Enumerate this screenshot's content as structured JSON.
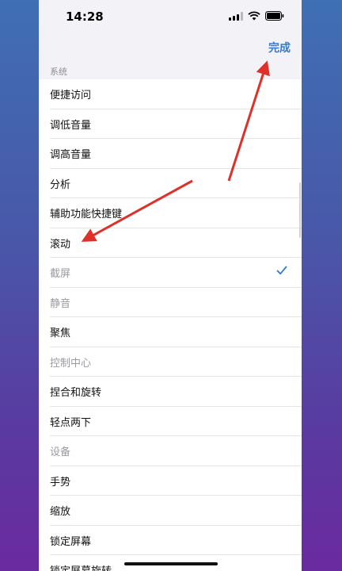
{
  "status_bar": {
    "time": "14:28"
  },
  "nav": {
    "done_label": "完成"
  },
  "section": {
    "title": "系统"
  },
  "items": [
    {
      "label": "便捷访问",
      "enabled": true,
      "checked": false
    },
    {
      "label": "调低音量",
      "enabled": true,
      "checked": false
    },
    {
      "label": "调高音量",
      "enabled": true,
      "checked": false
    },
    {
      "label": "分析",
      "enabled": true,
      "checked": false
    },
    {
      "label": "辅助功能快捷键",
      "enabled": true,
      "checked": false
    },
    {
      "label": "滚动",
      "enabled": true,
      "checked": false
    },
    {
      "label": "截屏",
      "enabled": false,
      "checked": true
    },
    {
      "label": "静音",
      "enabled": false,
      "checked": false
    },
    {
      "label": "聚焦",
      "enabled": true,
      "checked": false
    },
    {
      "label": "控制中心",
      "enabled": false,
      "checked": false
    },
    {
      "label": "捏合和旋转",
      "enabled": true,
      "checked": false
    },
    {
      "label": "轻点两下",
      "enabled": true,
      "checked": false
    },
    {
      "label": "设备",
      "enabled": false,
      "checked": false
    },
    {
      "label": "手势",
      "enabled": true,
      "checked": false
    },
    {
      "label": "缩放",
      "enabled": true,
      "checked": false
    },
    {
      "label": "锁定屏幕",
      "enabled": true,
      "checked": false
    },
    {
      "label": "锁定屏幕旋转",
      "enabled": true,
      "checked": false
    }
  ],
  "colors": {
    "accent": "#2f7bd6",
    "annotation_arrow": "#e0302a"
  }
}
